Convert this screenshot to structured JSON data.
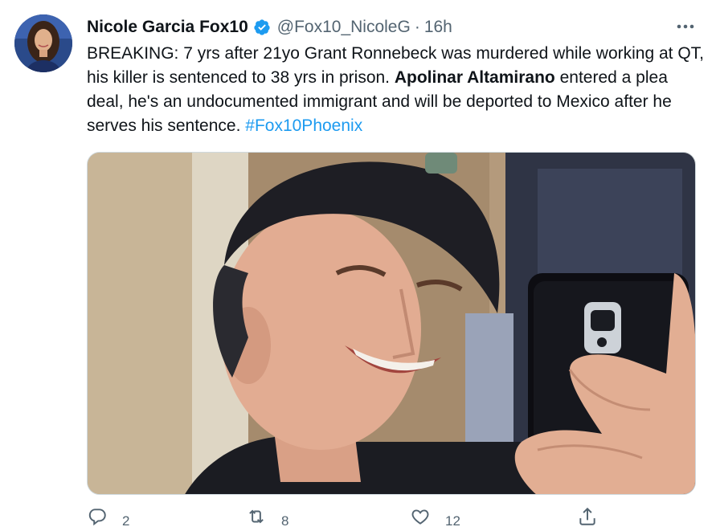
{
  "tweet": {
    "author_name": "Nicole Garcia Fox10",
    "handle": "@Fox10_NicoleG",
    "separator": "·",
    "time": "16h",
    "text_part1": "BREAKING: 7 yrs after 21yo Grant Ronnebeck was murdered while working at QT, his killer is sentenced to 38 yrs in prison. ",
    "text_bold": "Apolinar Altamirano",
    "text_part2": " entered a plea deal, he's an undocumented immigrant and will be deported to Mexico after he serves his sentence. ",
    "hashtag": "#Fox10Phoenix"
  },
  "actions": {
    "replies": "2",
    "retweets": "8",
    "likes": "12"
  },
  "icons": {
    "verified": "verified-badge-icon",
    "more": "more-options-icon",
    "reply": "reply-icon",
    "retweet": "retweet-icon",
    "like": "heart-icon",
    "share": "share-icon"
  },
  "colors": {
    "accent": "#1d9bf0",
    "text": "#0f1419",
    "secondary": "#536471"
  }
}
